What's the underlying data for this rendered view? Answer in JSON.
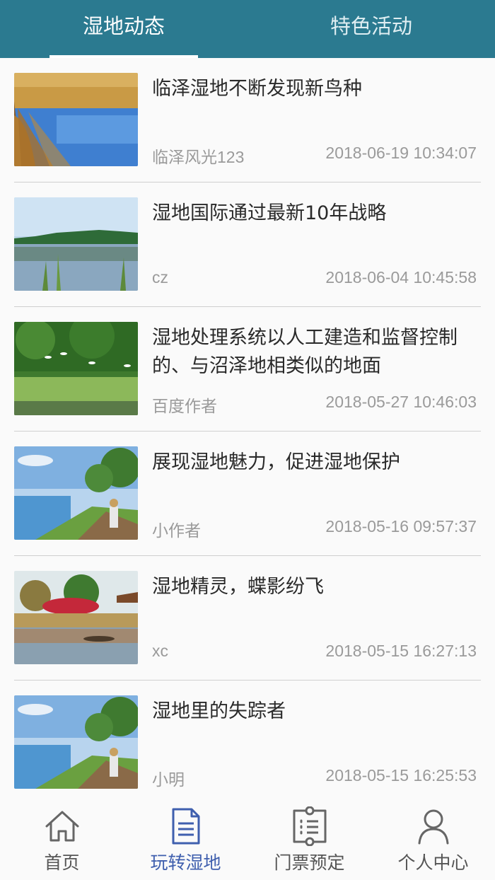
{
  "tabs": [
    {
      "label": "湿地动态",
      "active": true
    },
    {
      "label": "特色活动",
      "active": false
    }
  ],
  "articles": [
    {
      "title": "临泽湿地不断发现新鸟种",
      "author": "临泽风光123",
      "date": "2018-06-19 10:34:07",
      "image": "reeds-lake"
    },
    {
      "title": "湿地国际通过最新10年战略",
      "author": "cz",
      "date": "2018-06-04 10:45:58",
      "image": "lake-trees"
    },
    {
      "title": "湿地处理系统以人工建造和监督控制的、与沼泽地相类似的地面",
      "author": "百度作者",
      "date": "2018-05-27 10:46:03",
      "image": "forest-egrets"
    },
    {
      "title": "展现湿地魅力，促进湿地保护",
      "author": "小作者",
      "date": "2018-05-16 09:57:37",
      "image": "boardwalk-walkers"
    },
    {
      "title": "湿地精灵，蝶影纷飞",
      "author": "xc",
      "date": "2018-05-15 16:27:13",
      "image": "flowers-pavilion"
    },
    {
      "title": "湿地里的失踪者",
      "author": "小明",
      "date": "2018-05-15 16:25:53",
      "image": "boardwalk-walkers"
    }
  ],
  "bottom_nav": [
    {
      "label": "首页",
      "icon": "home-icon",
      "active": false
    },
    {
      "label": "玩转湿地",
      "icon": "document-icon",
      "active": true
    },
    {
      "label": "门票预定",
      "icon": "ticket-icon",
      "active": false
    },
    {
      "label": "个人中心",
      "icon": "person-icon",
      "active": false
    }
  ],
  "colors": {
    "header": "#2b7a90",
    "active_nav": "#3f5fae",
    "inactive_nav": "#555555",
    "muted_text": "#9a9a9a"
  }
}
